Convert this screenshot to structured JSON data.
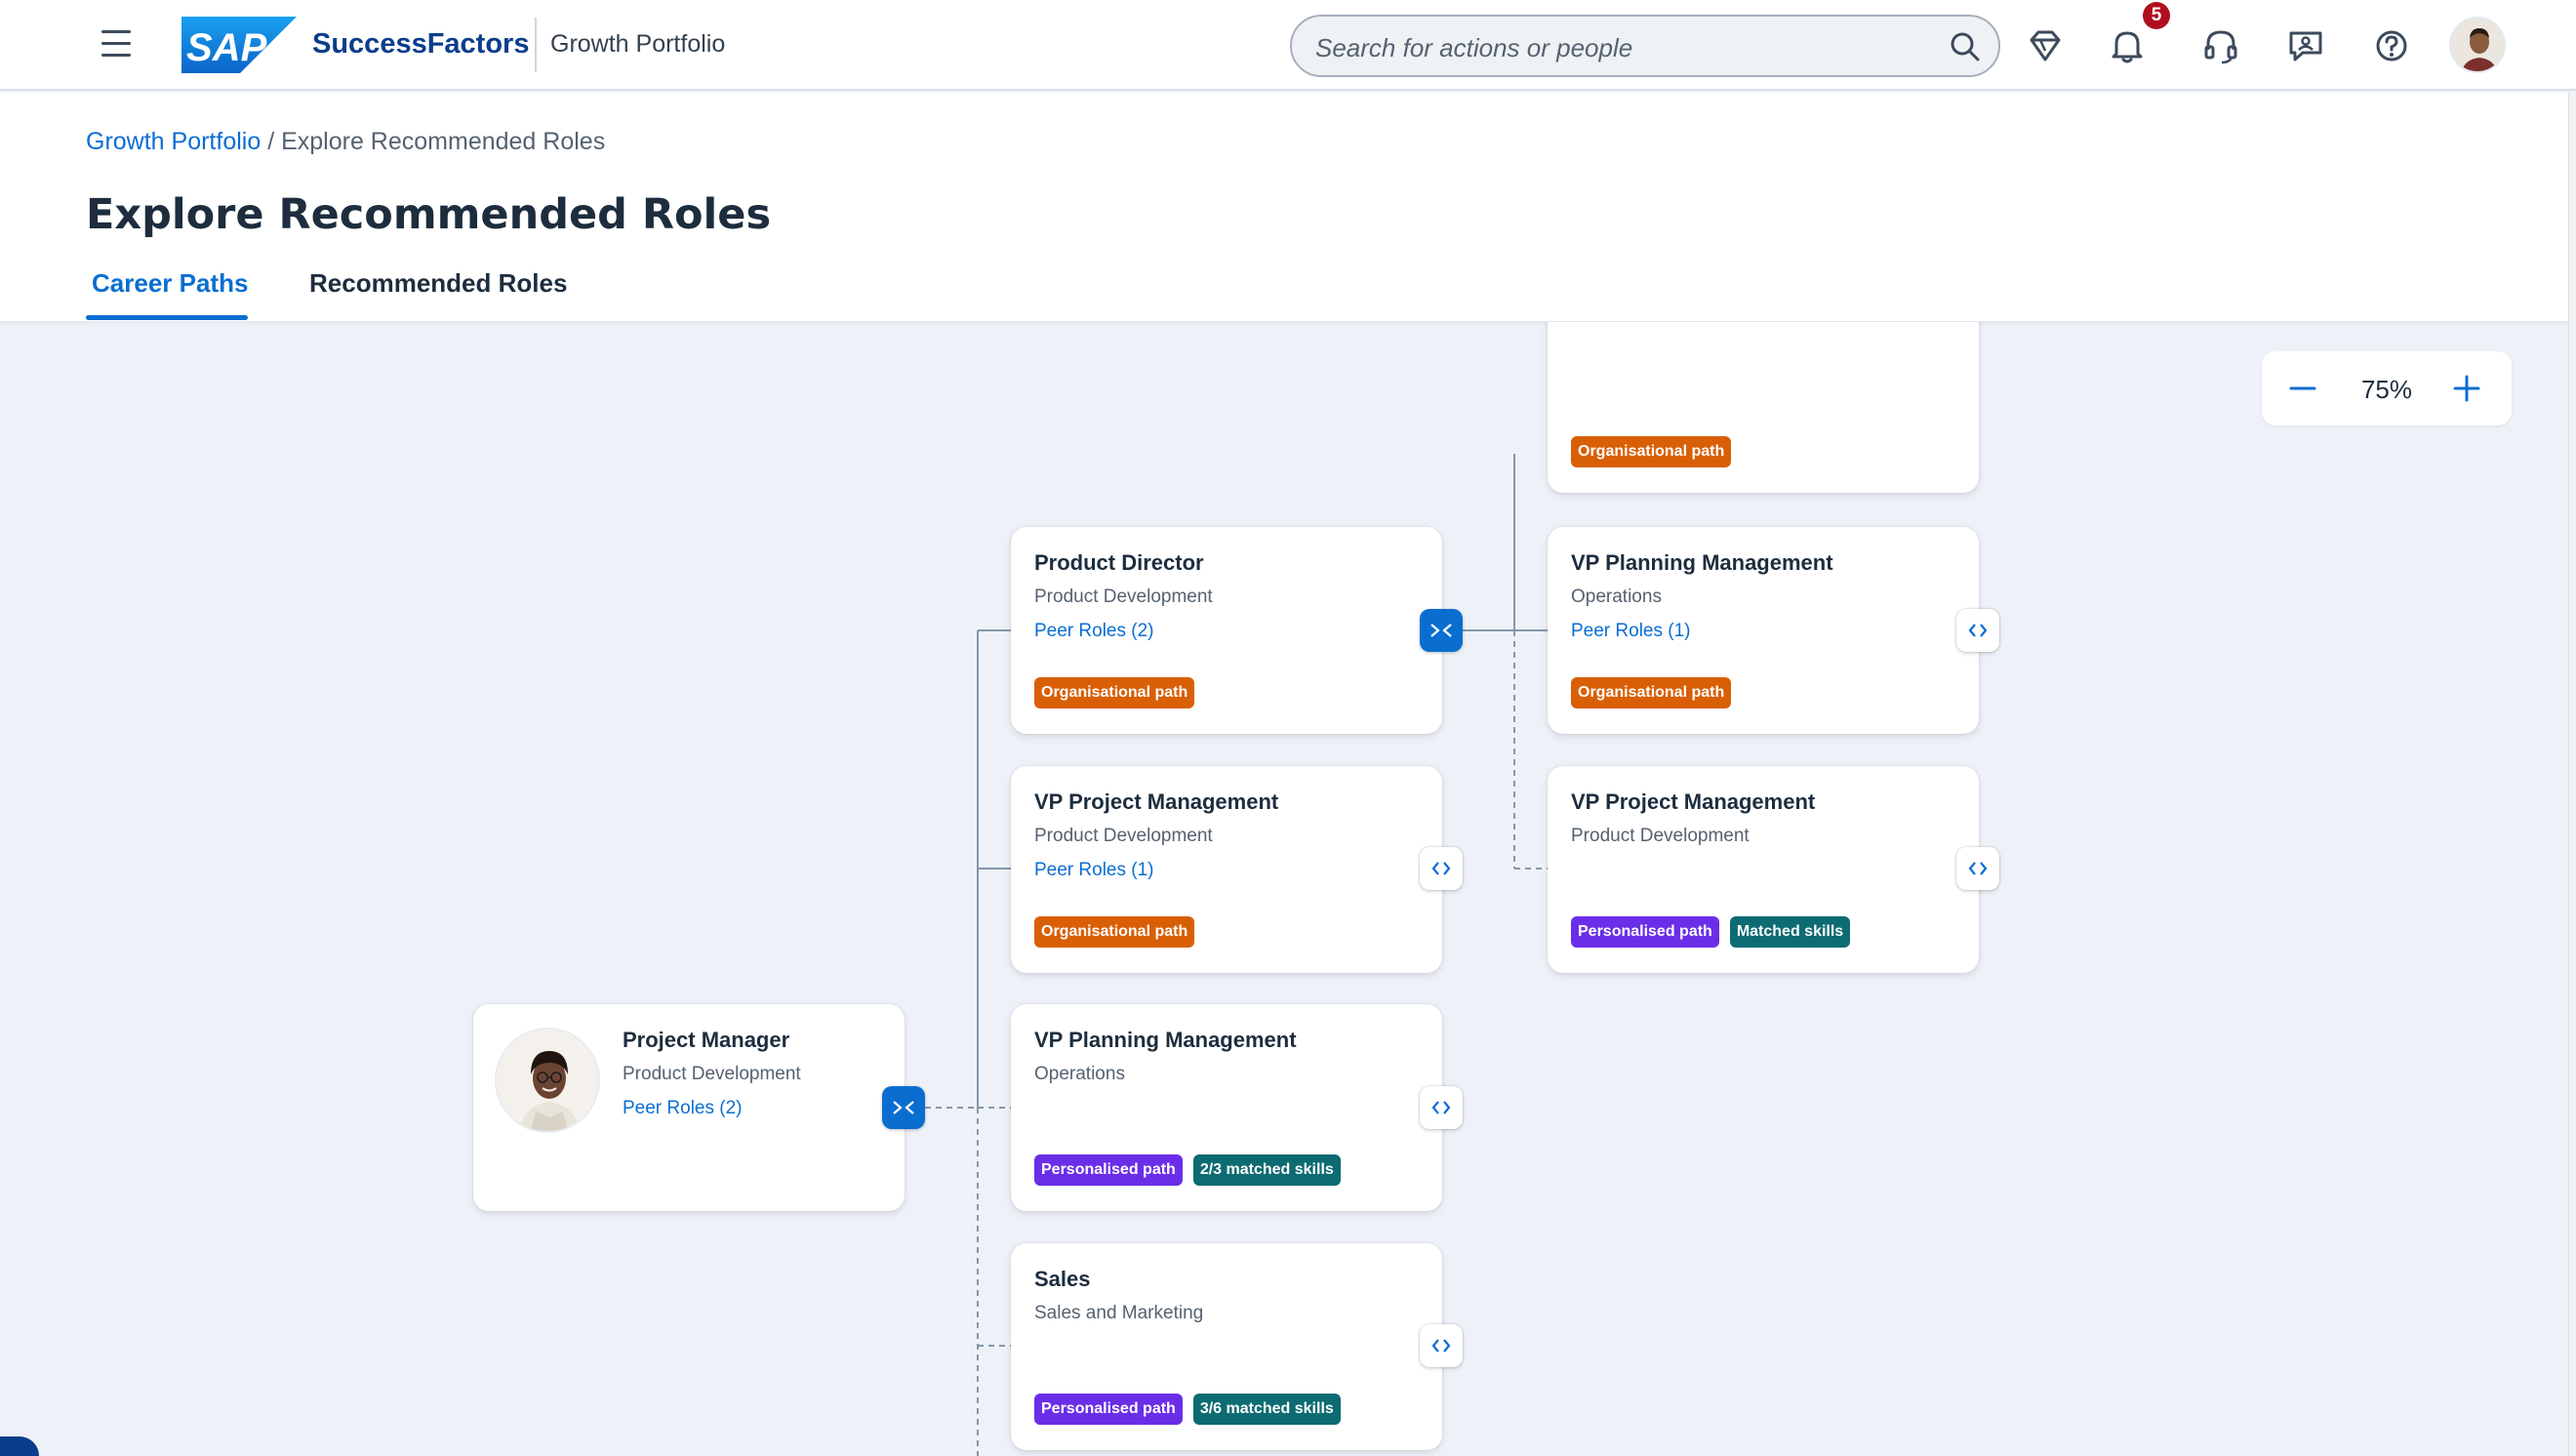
{
  "shell": {
    "logo_text": "SAP",
    "product": "SuccessFactors",
    "app_title": "Growth Portfolio",
    "search_placeholder": "Search for actions or people",
    "notification_count": "5",
    "icons": [
      "menu-icon",
      "search-icon",
      "diamond-icon",
      "bell-icon",
      "headset-icon",
      "chat-icon",
      "help-icon"
    ]
  },
  "breadcrumb": {
    "link": "Growth Portfolio",
    "separator": " / ",
    "current": "Explore Recommended Roles"
  },
  "page": {
    "title": "Explore Recommended Roles",
    "tabs": [
      {
        "label": "Career Paths",
        "selected": true
      },
      {
        "label": "Recommended Roles",
        "selected": false
      }
    ]
  },
  "zoom": {
    "value": "75%"
  },
  "colors": {
    "accent": "#0a6ed1",
    "organisational_tag": "#d95f06",
    "personalised_tag": "#6b2ee8",
    "skills_tag": "#0d6b72"
  },
  "cards": {
    "current": {
      "title": "Project Manager",
      "subtitle": "Product Development",
      "link": "Peer Roles (2)"
    },
    "product_director": {
      "title": "Product Director",
      "subtitle": "Product Development",
      "link": "Peer Roles (2)",
      "tags": [
        "Organisational path"
      ]
    },
    "vp_project_mgmt_1": {
      "title": "VP Project Management",
      "subtitle": "Product Development",
      "link": "Peer Roles (1)",
      "tags": [
        "Organisational path"
      ]
    },
    "vp_planning_mgmt_1": {
      "title": "VP Planning Management",
      "subtitle": "Operations",
      "tags": [
        "Personalised path",
        "2/3 matched skills"
      ]
    },
    "sales": {
      "title": "Sales",
      "subtitle": "Sales and Marketing",
      "tags": [
        "Personalised path",
        "3/6 matched skills"
      ]
    },
    "top_partial": {
      "tags": [
        "Organisational path"
      ]
    },
    "vp_planning_mgmt_2": {
      "title": "VP Planning Management",
      "subtitle": "Operations",
      "link": "Peer Roles (1)",
      "tags": [
        "Organisational path"
      ]
    },
    "vp_project_mgmt_2": {
      "title": "VP Project Management",
      "subtitle": "Product Development",
      "tags": [
        "Personalised path",
        "Matched skills"
      ]
    }
  }
}
